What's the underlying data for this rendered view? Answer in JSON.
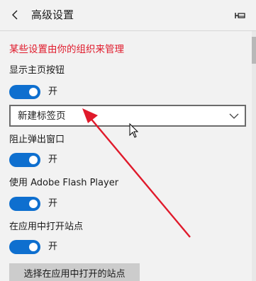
{
  "header": {
    "title": "高级设置",
    "back_icon": "chevron-left-icon",
    "pin_icon": "pin-icon"
  },
  "org_notice": "某些设置由你的组织来管理",
  "settings": {
    "home_button": {
      "label": "显示主页按钮",
      "state": "开",
      "enabled": true,
      "dropdown_value": "新建标签页"
    },
    "block_popups": {
      "label": "阻止弹出窗口",
      "state": "开",
      "enabled": true
    },
    "flash_player": {
      "label": "使用 Adobe Flash Player",
      "state": "开",
      "enabled": true
    },
    "open_in_apps": {
      "label": "在应用中打开站点",
      "state": "开",
      "enabled": true
    }
  },
  "choose_sites_button": "选择在应用中打开的站点",
  "colors": {
    "accent": "#0e6fcf",
    "notice": "#e01a2b",
    "annotation_arrow": "#e01a2b"
  }
}
